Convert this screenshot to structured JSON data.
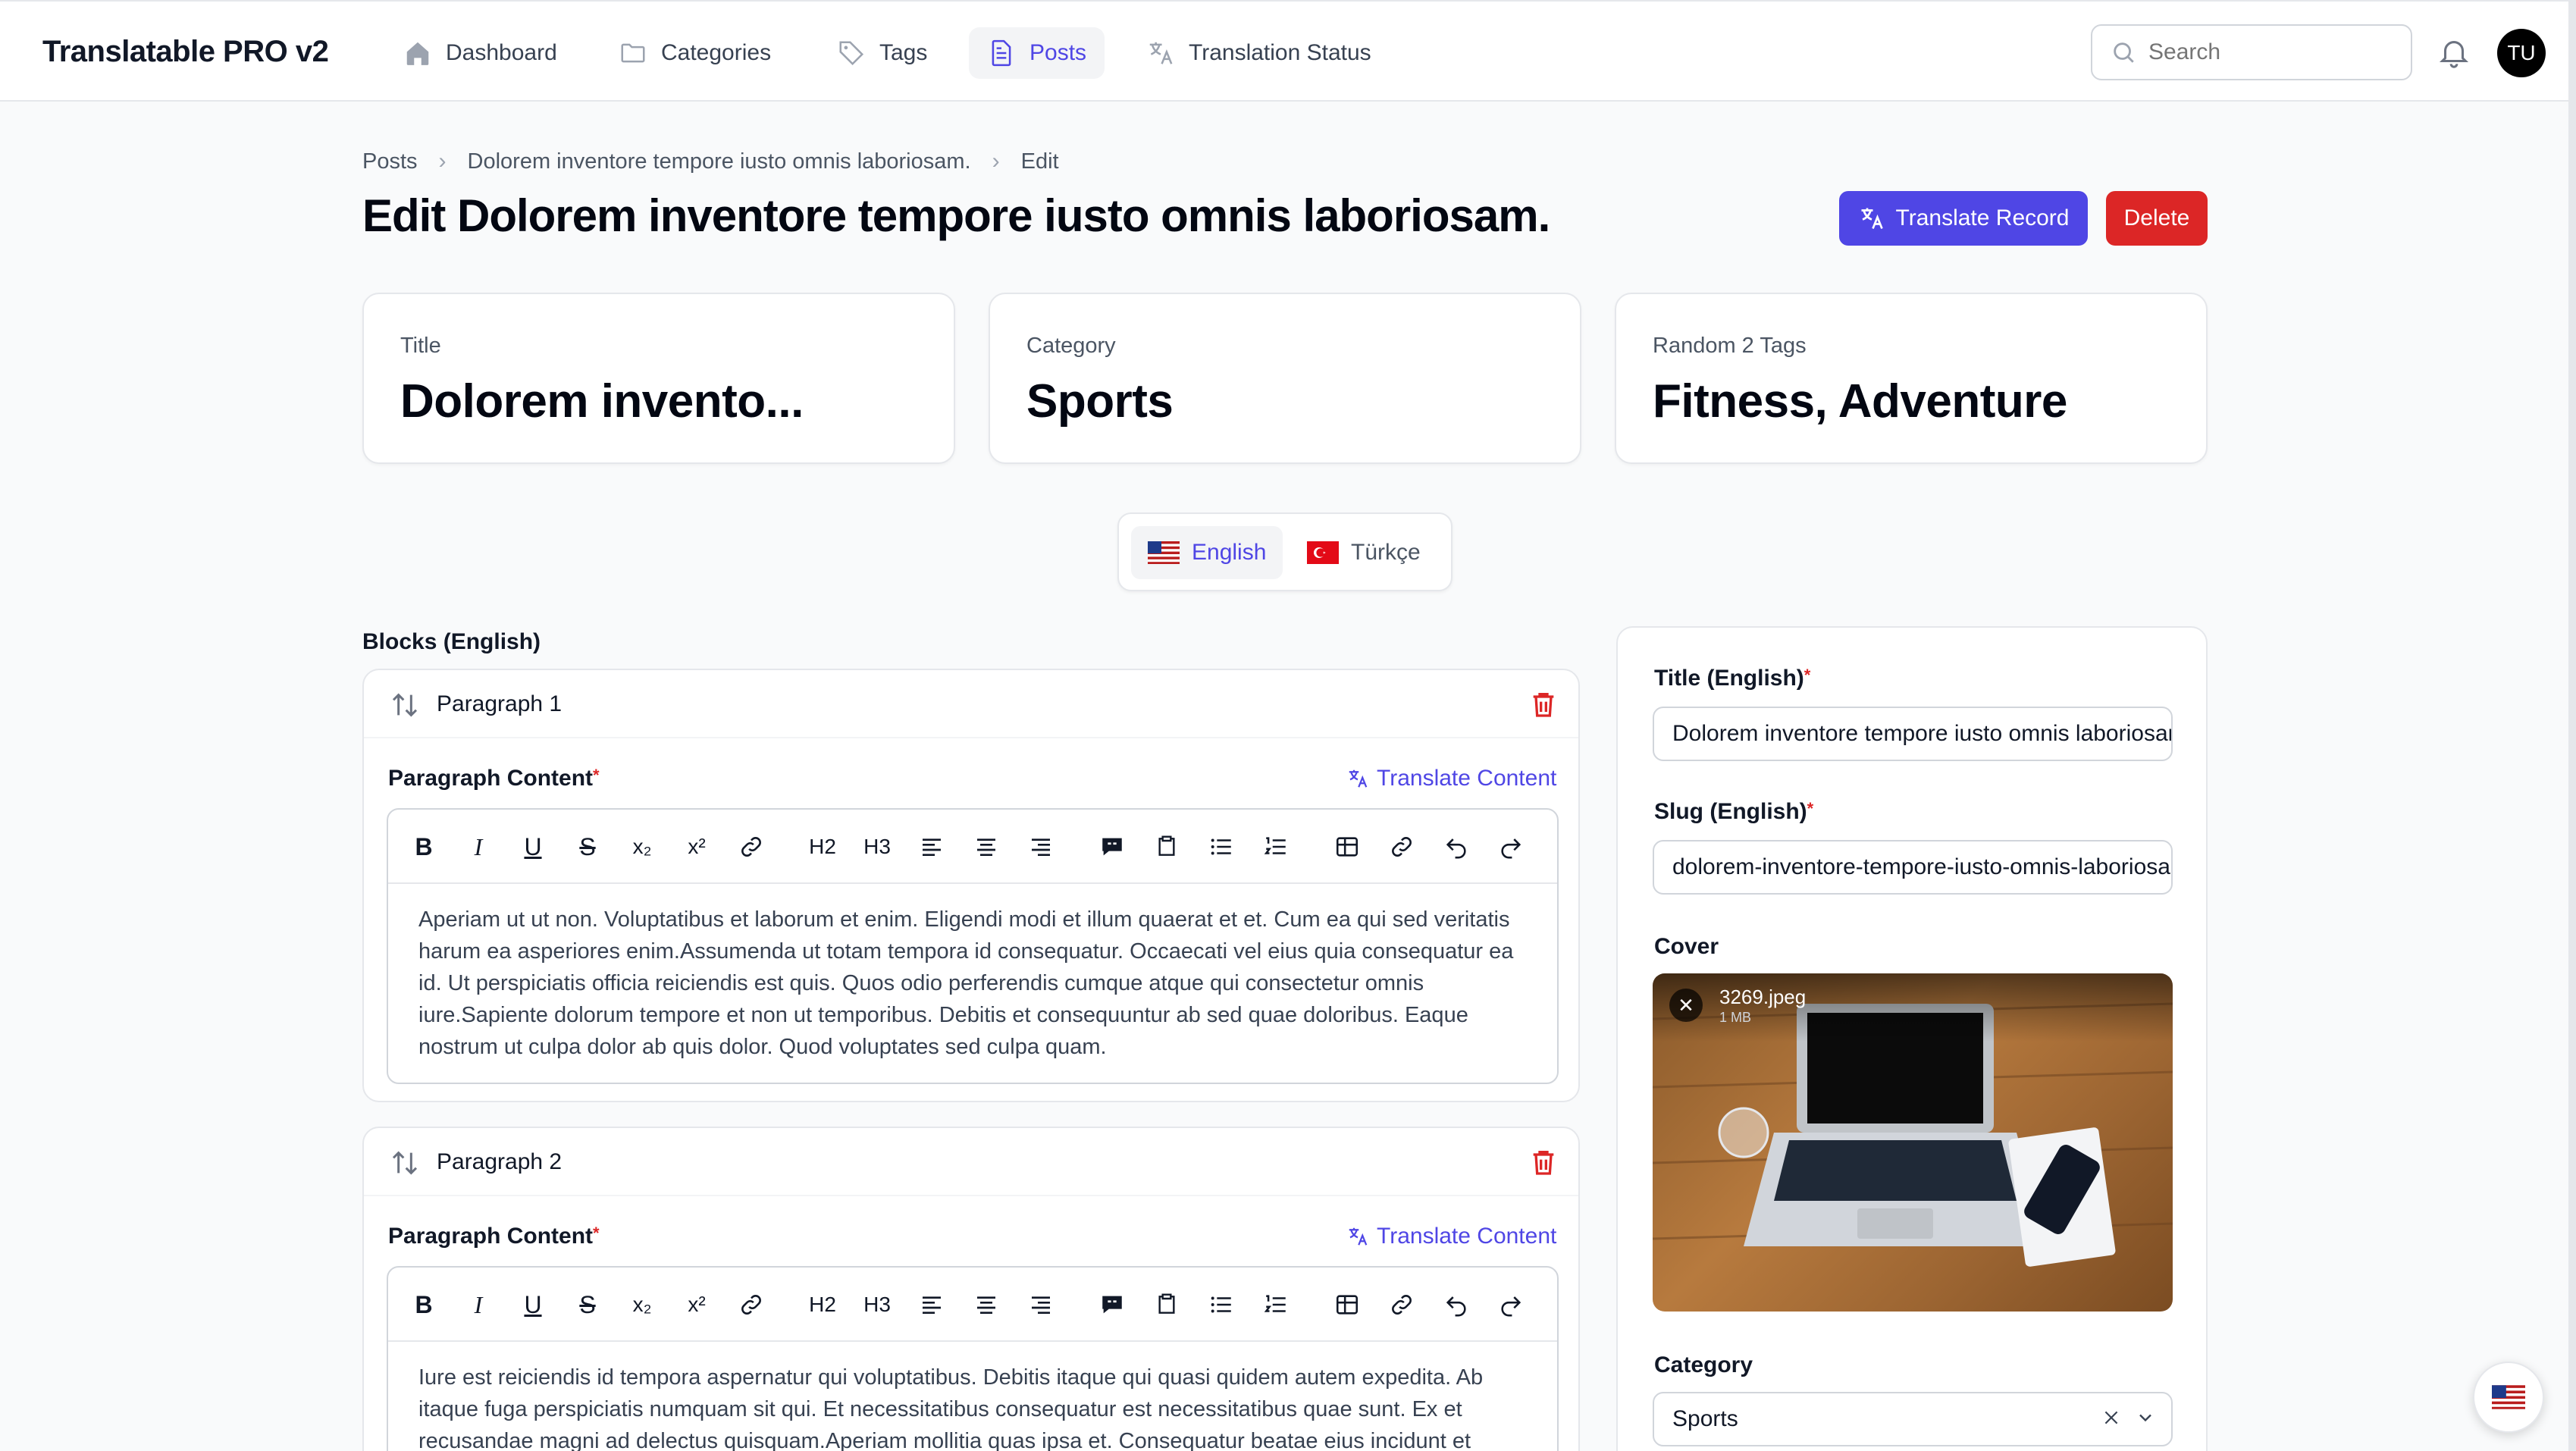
{
  "app": {
    "brand": "Translatable PRO v2"
  },
  "nav": {
    "items": [
      {
        "label": "Dashboard",
        "icon": "home-icon"
      },
      {
        "label": "Categories",
        "icon": "folder-icon"
      },
      {
        "label": "Tags",
        "icon": "tag-icon"
      },
      {
        "label": "Posts",
        "icon": "document-icon",
        "active": true
      },
      {
        "label": "Translation Status",
        "icon": "language-icon"
      }
    ]
  },
  "search": {
    "placeholder": "Search"
  },
  "user": {
    "initials": "TU"
  },
  "breadcrumb": [
    "Posts",
    "Dolorem inventore tempore iusto omnis laboriosam.",
    "Edit"
  ],
  "page": {
    "title": "Edit Dolorem inventore tempore iusto omnis laboriosam.",
    "translate_button": "Translate Record",
    "delete_button": "Delete"
  },
  "stats": [
    {
      "label": "Title",
      "value": "Dolorem invento..."
    },
    {
      "label": "Category",
      "value": "Sports"
    },
    {
      "label": "Random 2 Tags",
      "value": "Fitness, Adventure"
    }
  ],
  "languages": [
    {
      "label": "English",
      "active": true
    },
    {
      "label": "Türkçe",
      "active": false
    }
  ],
  "blocks": {
    "label": "Blocks (English)",
    "items": [
      {
        "name": "Paragraph 1",
        "field_label": "Paragraph Content",
        "translate_label": "Translate Content",
        "content": "Aperiam ut ut non. Voluptatibus et laborum et enim. Eligendi modi et illum quaerat et et. Cum ea qui sed veritatis harum ea asperiores enim.Assumenda ut totam tempora id consequatur. Occaecati vel eius quia consequatur ea id. Ut perspiciatis officia reiciendis est quis. Quos odio perferendis cumque atque qui consectetur omnis iure.Sapiente dolorum tempore et non ut temporibus. Debitis et consequuntur ab sed quae doloribus. Eaque nostrum ut culpa dolor ab quis dolor. Quod voluptates sed culpa quam."
      },
      {
        "name": "Paragraph 2",
        "field_label": "Paragraph Content",
        "translate_label": "Translate Content",
        "content": "Iure est reiciendis id tempora aspernatur qui voluptatibus. Debitis itaque qui quasi quidem autem expedita. Ab itaque fuga perspiciatis numquam sit qui. Et necessitatibus consequatur est necessitatibus quae sunt. Ex et recusandae magni ad delectus quisquam.Aperiam mollitia quas ipsa et. Consequatur beatae eius incidunt et"
      }
    ]
  },
  "toolbar": {
    "tools": [
      "bold-icon",
      "italic-icon",
      "underline-icon",
      "strikethrough-icon",
      "subscript-icon",
      "superscript-icon",
      "link-icon",
      "heading-2-icon",
      "heading-3-icon",
      "align-left-icon",
      "align-center-icon",
      "align-right-icon",
      "blockquote-icon",
      "code-block-icon",
      "bullet-list-icon",
      "ordered-list-icon",
      "table-icon",
      "attach-icon",
      "undo-icon",
      "redo-icon"
    ],
    "h2": "H2",
    "h3": "H3"
  },
  "side": {
    "title_label": "Title (English)",
    "title_value": "Dolorem inventore tempore iusto omnis laboriosam.",
    "slug_label": "Slug (English)",
    "slug_value": "dolorem-inventore-tempore-iusto-omnis-laboriosam",
    "cover_label": "Cover",
    "cover_file": "3269.jpeg",
    "cover_size": "1 MB",
    "category_label": "Category",
    "category_value": "Sports"
  },
  "colors": {
    "primary": "#4f46e5",
    "danger": "#dc2626"
  }
}
